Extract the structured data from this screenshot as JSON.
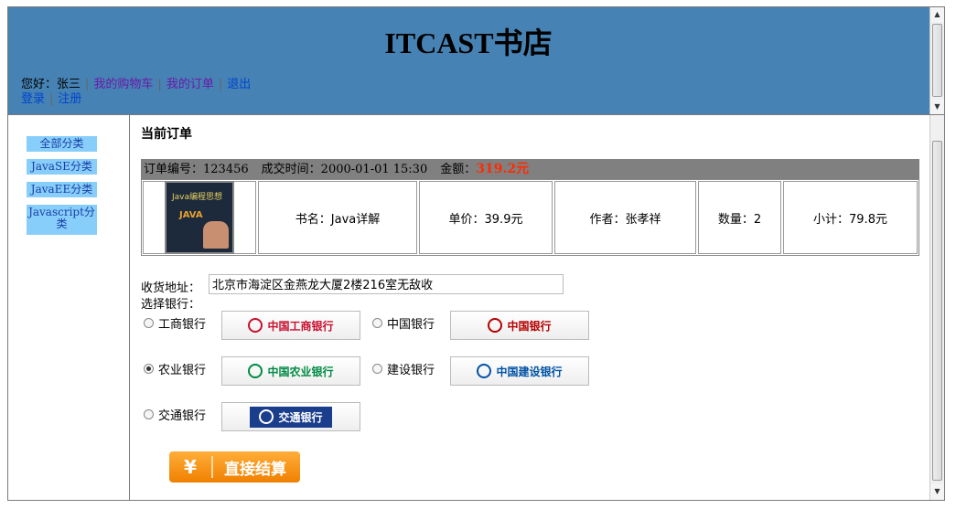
{
  "header": {
    "title": "ITCAST书店",
    "greeting": "您好：张三",
    "links": [
      "我的购物车",
      "我的订单",
      "退出"
    ],
    "login_links": [
      "登录",
      "注册"
    ]
  },
  "sidebar": {
    "categories": [
      "全部分类",
      "JavaSE分类",
      "JavaEE分类",
      "Javascript分类"
    ]
  },
  "main": {
    "section_title": "当前订单",
    "order": {
      "number_label": "订单编号：",
      "number": "123456",
      "time_label": "成交时间：",
      "time": "2000-01-01 15:30",
      "amount_label": "金额：",
      "amount": "319.2元"
    },
    "item": {
      "book_image_name": "Java编程思想",
      "book_image_sub": "JAVA",
      "name": "书名：Java详解",
      "price": "单价：39.9元",
      "author": "作者：张孝祥",
      "quantity": "数量：2",
      "subtotal": "小计：79.8元"
    },
    "address_label": "收货地址：",
    "address_value": "北京市海淀区金燕龙大厦2楼216室无敌收",
    "bank_label": "选择银行：",
    "banks": [
      {
        "name": "工商银行",
        "logo_text": "中国工商银行",
        "color": "#c8102e",
        "selected": false
      },
      {
        "name": "中国银行",
        "logo_text": "中国银行",
        "color": "#b40000",
        "selected": false
      },
      {
        "name": "农业银行",
        "logo_text": "中国农业银行",
        "color": "#008a45",
        "selected": true
      },
      {
        "name": "建设银行",
        "logo_text": "中国建设银行",
        "color": "#0052a5",
        "selected": false
      },
      {
        "name": "交通银行",
        "logo_text": "交通银行",
        "color": "#1a3e8c",
        "selected": false
      }
    ],
    "pay_button": {
      "icon": "¥",
      "label": "直接结算"
    }
  }
}
